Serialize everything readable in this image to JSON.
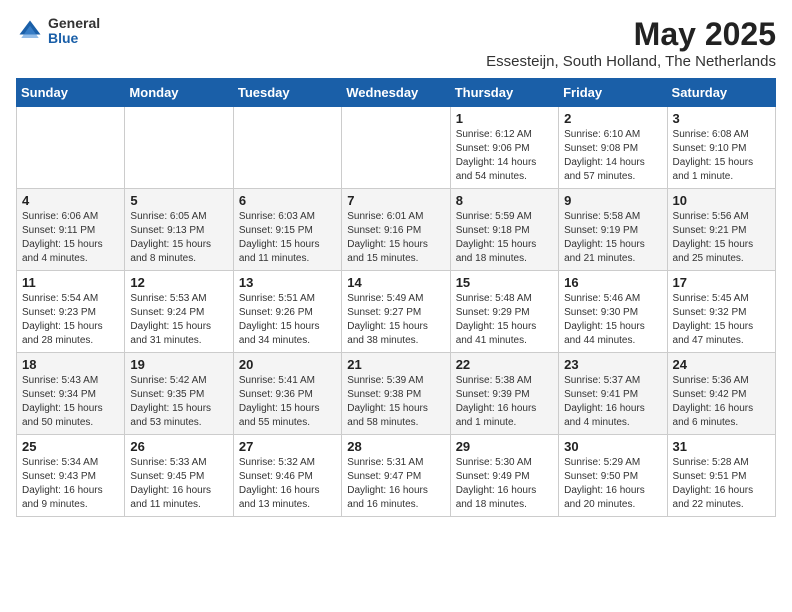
{
  "logo": {
    "general": "General",
    "blue": "Blue"
  },
  "title": "May 2025",
  "subtitle": "Essesteijn, South Holland, The Netherlands",
  "days_of_week": [
    "Sunday",
    "Monday",
    "Tuesday",
    "Wednesday",
    "Thursday",
    "Friday",
    "Saturday"
  ],
  "weeks": [
    [
      {
        "day": "",
        "info": ""
      },
      {
        "day": "",
        "info": ""
      },
      {
        "day": "",
        "info": ""
      },
      {
        "day": "",
        "info": ""
      },
      {
        "day": "1",
        "info": "Sunrise: 6:12 AM\nSunset: 9:06 PM\nDaylight: 14 hours\nand 54 minutes."
      },
      {
        "day": "2",
        "info": "Sunrise: 6:10 AM\nSunset: 9:08 PM\nDaylight: 14 hours\nand 57 minutes."
      },
      {
        "day": "3",
        "info": "Sunrise: 6:08 AM\nSunset: 9:10 PM\nDaylight: 15 hours\nand 1 minute."
      }
    ],
    [
      {
        "day": "4",
        "info": "Sunrise: 6:06 AM\nSunset: 9:11 PM\nDaylight: 15 hours\nand 4 minutes."
      },
      {
        "day": "5",
        "info": "Sunrise: 6:05 AM\nSunset: 9:13 PM\nDaylight: 15 hours\nand 8 minutes."
      },
      {
        "day": "6",
        "info": "Sunrise: 6:03 AM\nSunset: 9:15 PM\nDaylight: 15 hours\nand 11 minutes."
      },
      {
        "day": "7",
        "info": "Sunrise: 6:01 AM\nSunset: 9:16 PM\nDaylight: 15 hours\nand 15 minutes."
      },
      {
        "day": "8",
        "info": "Sunrise: 5:59 AM\nSunset: 9:18 PM\nDaylight: 15 hours\nand 18 minutes."
      },
      {
        "day": "9",
        "info": "Sunrise: 5:58 AM\nSunset: 9:19 PM\nDaylight: 15 hours\nand 21 minutes."
      },
      {
        "day": "10",
        "info": "Sunrise: 5:56 AM\nSunset: 9:21 PM\nDaylight: 15 hours\nand 25 minutes."
      }
    ],
    [
      {
        "day": "11",
        "info": "Sunrise: 5:54 AM\nSunset: 9:23 PM\nDaylight: 15 hours\nand 28 minutes."
      },
      {
        "day": "12",
        "info": "Sunrise: 5:53 AM\nSunset: 9:24 PM\nDaylight: 15 hours\nand 31 minutes."
      },
      {
        "day": "13",
        "info": "Sunrise: 5:51 AM\nSunset: 9:26 PM\nDaylight: 15 hours\nand 34 minutes."
      },
      {
        "day": "14",
        "info": "Sunrise: 5:49 AM\nSunset: 9:27 PM\nDaylight: 15 hours\nand 38 minutes."
      },
      {
        "day": "15",
        "info": "Sunrise: 5:48 AM\nSunset: 9:29 PM\nDaylight: 15 hours\nand 41 minutes."
      },
      {
        "day": "16",
        "info": "Sunrise: 5:46 AM\nSunset: 9:30 PM\nDaylight: 15 hours\nand 44 minutes."
      },
      {
        "day": "17",
        "info": "Sunrise: 5:45 AM\nSunset: 9:32 PM\nDaylight: 15 hours\nand 47 minutes."
      }
    ],
    [
      {
        "day": "18",
        "info": "Sunrise: 5:43 AM\nSunset: 9:34 PM\nDaylight: 15 hours\nand 50 minutes."
      },
      {
        "day": "19",
        "info": "Sunrise: 5:42 AM\nSunset: 9:35 PM\nDaylight: 15 hours\nand 53 minutes."
      },
      {
        "day": "20",
        "info": "Sunrise: 5:41 AM\nSunset: 9:36 PM\nDaylight: 15 hours\nand 55 minutes."
      },
      {
        "day": "21",
        "info": "Sunrise: 5:39 AM\nSunset: 9:38 PM\nDaylight: 15 hours\nand 58 minutes."
      },
      {
        "day": "22",
        "info": "Sunrise: 5:38 AM\nSunset: 9:39 PM\nDaylight: 16 hours\nand 1 minute."
      },
      {
        "day": "23",
        "info": "Sunrise: 5:37 AM\nSunset: 9:41 PM\nDaylight: 16 hours\nand 4 minutes."
      },
      {
        "day": "24",
        "info": "Sunrise: 5:36 AM\nSunset: 9:42 PM\nDaylight: 16 hours\nand 6 minutes."
      }
    ],
    [
      {
        "day": "25",
        "info": "Sunrise: 5:34 AM\nSunset: 9:43 PM\nDaylight: 16 hours\nand 9 minutes."
      },
      {
        "day": "26",
        "info": "Sunrise: 5:33 AM\nSunset: 9:45 PM\nDaylight: 16 hours\nand 11 minutes."
      },
      {
        "day": "27",
        "info": "Sunrise: 5:32 AM\nSunset: 9:46 PM\nDaylight: 16 hours\nand 13 minutes."
      },
      {
        "day": "28",
        "info": "Sunrise: 5:31 AM\nSunset: 9:47 PM\nDaylight: 16 hours\nand 16 minutes."
      },
      {
        "day": "29",
        "info": "Sunrise: 5:30 AM\nSunset: 9:49 PM\nDaylight: 16 hours\nand 18 minutes."
      },
      {
        "day": "30",
        "info": "Sunrise: 5:29 AM\nSunset: 9:50 PM\nDaylight: 16 hours\nand 20 minutes."
      },
      {
        "day": "31",
        "info": "Sunrise: 5:28 AM\nSunset: 9:51 PM\nDaylight: 16 hours\nand 22 minutes."
      }
    ]
  ]
}
